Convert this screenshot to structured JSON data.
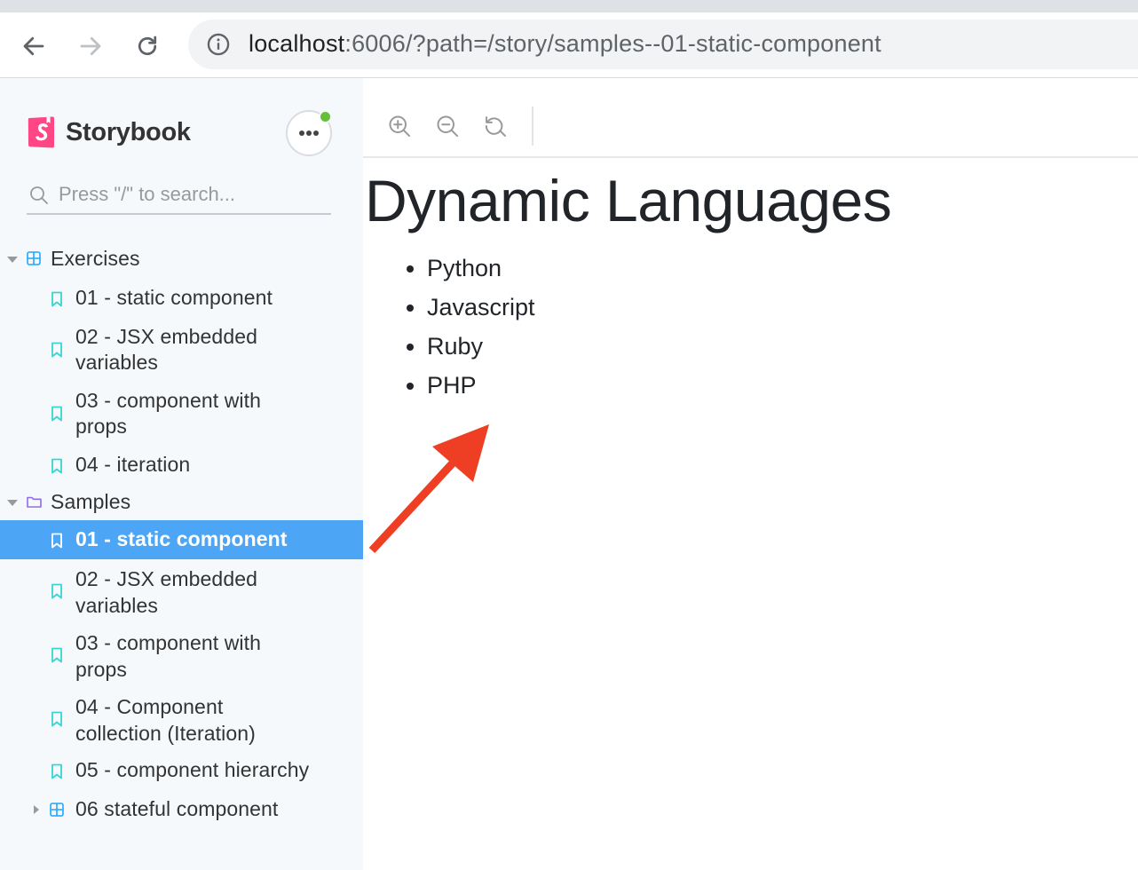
{
  "browser": {
    "url_host": "localhost",
    "url_rest": ":6006/?path=/story/samples--01-static-component"
  },
  "sidebar": {
    "brand": "Storybook",
    "search_placeholder": "Press \"/\" to search...",
    "tree": [
      {
        "label": "Exercises",
        "kind": "component-group",
        "expanded": true
      },
      {
        "label": "01 - static component",
        "kind": "story"
      },
      {
        "label": "02 - JSX embedded variables",
        "kind": "story"
      },
      {
        "label": "03 - component with props",
        "kind": "story"
      },
      {
        "label": "04 - iteration",
        "kind": "story"
      },
      {
        "label": "Samples",
        "kind": "folder",
        "expanded": true
      },
      {
        "label": "01 - static component",
        "kind": "story",
        "selected": true
      },
      {
        "label": "02 - JSX embedded variables",
        "kind": "story"
      },
      {
        "label": "03 - component with props",
        "kind": "story"
      },
      {
        "label": "04 - Component collection (Iteration)",
        "kind": "story"
      },
      {
        "label": "05 - component hierarchy",
        "kind": "story"
      },
      {
        "label": "06 stateful component",
        "kind": "component-group",
        "expanded": false
      }
    ]
  },
  "preview": {
    "heading": "Dynamic Languages",
    "items": [
      "Python",
      "Javascript",
      "Ruby",
      "PHP"
    ]
  },
  "colors": {
    "selected_bg": "#4ca6f5",
    "story_icon": "#37d5d3",
    "brand": "#ff4785",
    "annotation_arrow": "#ee3f24"
  }
}
